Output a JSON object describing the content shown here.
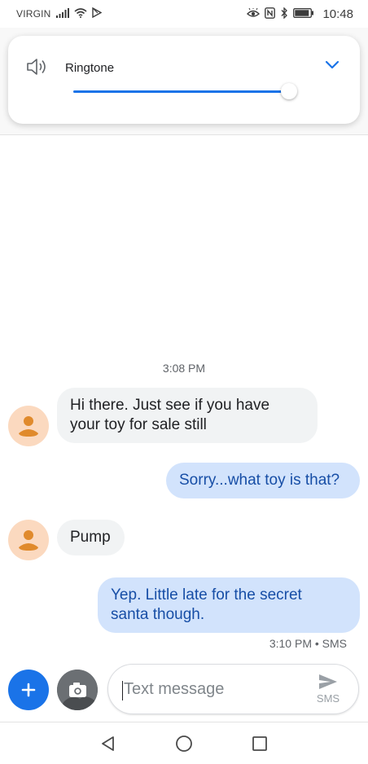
{
  "status_bar": {
    "carrier": "VIRGIN",
    "time": "10:48"
  },
  "volume_panel": {
    "label": "Ringtone",
    "level": 0.98,
    "accent_color": "#1a73e8",
    "speaker_icon": "speaker-icon",
    "expand_icon": "chevron-down-icon"
  },
  "conversation": {
    "timestamp": "3:08 PM",
    "messages": [
      {
        "direction": "incoming",
        "lines": [
          "Hi there. Just see if you have",
          "your toy for sale still"
        ]
      },
      {
        "direction": "outgoing",
        "lines": [
          "Sorry...what toy is that?"
        ]
      },
      {
        "direction": "incoming",
        "lines": [
          "Pump"
        ]
      },
      {
        "direction": "outgoing",
        "lines": [
          "Yep. Little late for the secret",
          "santa though."
        ]
      }
    ],
    "last_meta": "3:10 PM • SMS",
    "incoming_bubble_color": "#f1f3f4",
    "outgoing_bubble_color": "#d2e3fc"
  },
  "compose": {
    "placeholder": "Text message",
    "send_label": "SMS",
    "add_icon": "plus-icon",
    "camera_icon": "camera-icon",
    "send_icon": "send-icon"
  },
  "nav": {
    "back_icon": "back-triangle-icon",
    "home_icon": "home-circle-icon",
    "recents_icon": "recents-square-icon"
  }
}
